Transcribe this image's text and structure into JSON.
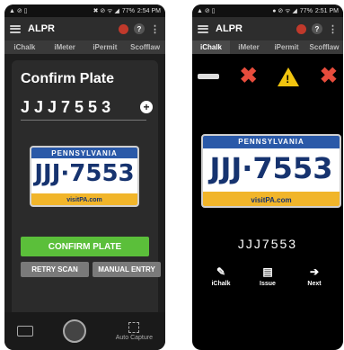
{
  "left": {
    "status": {
      "icons_left": "▲ ⊘ ▯",
      "icons_right": "✖ ⊘ ᯤ ◢",
      "battery": "77%",
      "time": "2:54 PM"
    },
    "app_title": "ALPR",
    "tabs": [
      "iChalk",
      "iMeter",
      "iPermit",
      "Scofflaw"
    ],
    "confirm_title": "Confirm Plate",
    "plate_chars": "JJJ7553",
    "plate_image": {
      "state": "PENNSYLVANIA",
      "number": "JJJ·7553",
      "site": "visitPA.com"
    },
    "confirm_label": "CONFIRM PLATE",
    "retry_label": "RETRY SCAN",
    "manual_label": "MANUAL ENTRY",
    "auto_capture_label": "Auto Capture"
  },
  "right": {
    "status": {
      "icons_left": "▲ ⊘ ▯",
      "icons_right": "● ⊘ ᯤ ◢",
      "battery": "77%",
      "time": "2:51 PM"
    },
    "app_title": "ALPR",
    "tabs": [
      "iChalk",
      "iMeter",
      "iPermit",
      "Scofflaw"
    ],
    "plate_image": {
      "state": "PENNSYLVANIA",
      "number": "JJJ·7553",
      "site": "visitPA.com"
    },
    "plate_text": "JJJ7553",
    "nav": [
      {
        "icon": "pencil",
        "label": "iChalk"
      },
      {
        "icon": "document",
        "label": "Issue"
      },
      {
        "icon": "arrow-right",
        "label": "Next"
      }
    ]
  },
  "colors": {
    "confirm_green": "#5bbf3a",
    "plate_blue": "#2a59a8",
    "plate_gold": "#f1b52a",
    "x_red": "#e74c3c",
    "warn_yellow": "#f1c40f"
  }
}
